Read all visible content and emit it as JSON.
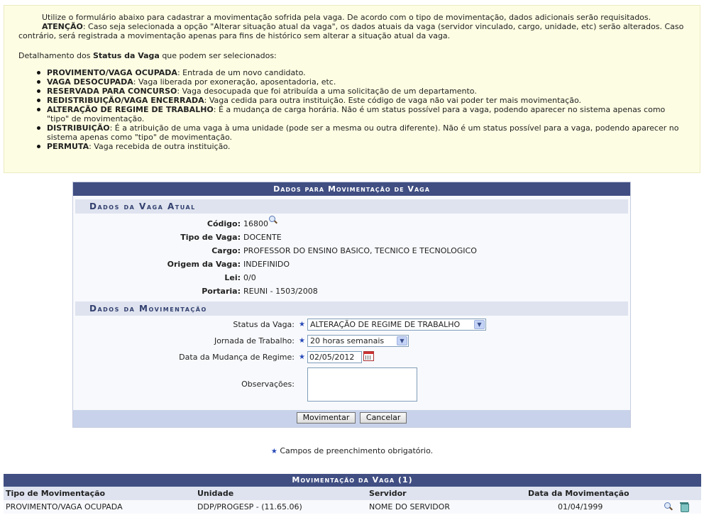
{
  "info": {
    "p1": "Utilize o formulário abaixo para cadastrar a movimentação sofrida pela vaga. De acordo com o tipo de movimentação, dados adicionais serão requisitados.",
    "p2_label": "ATENÇÃO",
    "p2_text": ": Caso seja selecionada a opção \"Alterar situação atual da vaga\", os dados atuais da vaga (servidor vinculado, cargo, unidade, etc) serão alterados. Caso contrário, será registrada a movimentação apenas para fins de histórico sem alterar a situação atual da vaga.",
    "p3_pre": "Detalhamento dos ",
    "p3_bold": "Status da Vaga",
    "p3_post": " que podem ser selecionados:",
    "items": [
      {
        "term": "PROVIMENTO/VAGA OCUPADA",
        "desc": ": Entrada de um novo candidato."
      },
      {
        "term": "VAGA DESOCUPADA",
        "desc": ": Vaga liberada por exoneração, aposentadoria, etc."
      },
      {
        "term": "RESERVADA PARA CONCURSO",
        "desc": ": Vaga desocupada que foi atribuída a uma solicitação de um departamento."
      },
      {
        "term": "REDISTRIBUIÇÃO/VAGA ENCERRADA",
        "desc": ": Vaga cedida para outra instituição. Este código de vaga não vai poder ter mais movimentação."
      },
      {
        "term": "ALTERAÇÃO DE REGIME DE TRABALHO",
        "desc": ": É a mudança de carga horária. Não é um status possível para a vaga, podendo aparecer no sistema apenas como \"tipo\" de movimentação."
      },
      {
        "term": "DISTRIBUIÇÃO",
        "desc": ": É a atribuição de uma vaga à uma unidade (pode ser a mesma ou outra diferente). Não é um status possível para a vaga, podendo aparecer no sistema apenas como \"tipo\" de movimentação."
      },
      {
        "term": "PERMUTA",
        "desc": ": Vaga recebida de outra instituição."
      }
    ]
  },
  "form": {
    "title": "Dados para Movimentação de Vaga",
    "section_atual": "Dados da Vaga Atual",
    "fields": {
      "codigo": {
        "label": "Código:",
        "value": "16800"
      },
      "tipo": {
        "label": "Tipo de Vaga:",
        "value": "DOCENTE"
      },
      "cargo": {
        "label": "Cargo:",
        "value": "PROFESSOR DO ENSINO BASICO, TECNICO E TECNOLOGICO"
      },
      "origem": {
        "label": "Origem da Vaga:",
        "value": "INDEFINIDO"
      },
      "lei": {
        "label": "Lei:",
        "value": "0/0"
      },
      "portaria": {
        "label": "Portaria:",
        "value": "REUNI - 1503/2008"
      }
    },
    "section_mov": "Dados da Movimentação",
    "status": {
      "label": "Status da Vaga:",
      "value": "ALTERAÇÃO DE REGIME DE TRABALHO"
    },
    "jornada": {
      "label": "Jornada de Trabalho:",
      "value": "20 horas semanais"
    },
    "data": {
      "label": "Data da Mudança de Regime:",
      "value": "02/05/2012"
    },
    "obs": {
      "label": "Observações:",
      "value": ""
    },
    "btn_movimentar": "Movimentar",
    "btn_cancelar": "Cancelar"
  },
  "legend": "Campos de preenchimento obrigatório.",
  "table": {
    "title": "Movimentação da Vaga (1)",
    "headers": [
      "Tipo de Movimentação",
      "Unidade",
      "Servidor",
      "Data da Movimentação"
    ],
    "rows": [
      [
        "PROVIMENTO/VAGA OCUPADA",
        "DDP/PROGESP - (11.65.06)",
        "NOME DO SERVIDOR",
        "01/04/1999"
      ]
    ]
  }
}
